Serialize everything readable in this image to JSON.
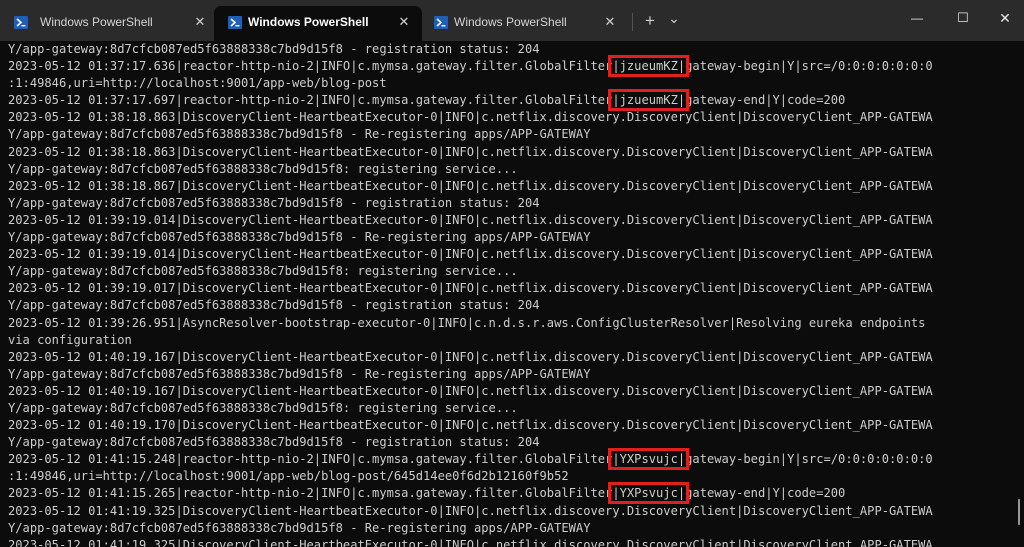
{
  "tabs": [
    {
      "label": "Windows PowerShell",
      "active": false
    },
    {
      "label": "Windows PowerShell",
      "active": true
    },
    {
      "label": "Windows PowerShell",
      "active": false
    }
  ],
  "toolbar": {
    "new_tab": "+",
    "dropdown": "⌄",
    "close_glyph": "✕"
  },
  "window_controls": {
    "minimize": "—",
    "maximize": "☐",
    "close": "✕"
  },
  "colors": {
    "terminal_bg": "#0c0c0c",
    "text": "#cccccc",
    "highlight_box": "#e0201f",
    "powershell_icon": "#1f5fb5"
  },
  "terminal": {
    "lines": [
      {
        "segments": [
          {
            "text": "Y/app-gateway:8d7cfcb087ed5f63888338c7bd9d15f8 - registration status: 204"
          }
        ]
      },
      {
        "segments": [
          {
            "text": "2023-05-12 01:37:17.636|reactor-http-nio-2|INFO|c.mymsa.gateway.filter.GlobalFilter"
          },
          {
            "text": "|jzueumKZ|",
            "highlight": true
          },
          {
            "text": "gateway-begin|Y|src=/0:0:0:0:0:0:0"
          }
        ]
      },
      {
        "segments": [
          {
            "text": ":1:49846,uri=http://localhost:9001/app-web/blog-post"
          }
        ]
      },
      {
        "segments": [
          {
            "text": "2023-05-12 01:37:17.697|reactor-http-nio-2|INFO|c.mymsa.gateway.filter.GlobalFilter"
          },
          {
            "text": "|jzueumKZ|",
            "highlight": true
          },
          {
            "text": "gateway-end|Y|code=200"
          }
        ]
      },
      {
        "segments": [
          {
            "text": "2023-05-12 01:38:18.863|DiscoveryClient-HeartbeatExecutor-0|INFO|c.netflix.discovery.DiscoveryClient|DiscoveryClient_APP-GATEWA"
          }
        ]
      },
      {
        "segments": [
          {
            "text": "Y/app-gateway:8d7cfcb087ed5f63888338c7bd9d15f8 - Re-registering apps/APP-GATEWAY"
          }
        ]
      },
      {
        "segments": [
          {
            "text": "2023-05-12 01:38:18.863|DiscoveryClient-HeartbeatExecutor-0|INFO|c.netflix.discovery.DiscoveryClient|DiscoveryClient_APP-GATEWA"
          }
        ]
      },
      {
        "segments": [
          {
            "text": "Y/app-gateway:8d7cfcb087ed5f63888338c7bd9d15f8: registering service..."
          }
        ]
      },
      {
        "segments": [
          {
            "text": "2023-05-12 01:38:18.867|DiscoveryClient-HeartbeatExecutor-0|INFO|c.netflix.discovery.DiscoveryClient|DiscoveryClient_APP-GATEWA"
          }
        ]
      },
      {
        "segments": [
          {
            "text": "Y/app-gateway:8d7cfcb087ed5f63888338c7bd9d15f8 - registration status: 204"
          }
        ]
      },
      {
        "segments": [
          {
            "text": "2023-05-12 01:39:19.014|DiscoveryClient-HeartbeatExecutor-0|INFO|c.netflix.discovery.DiscoveryClient|DiscoveryClient_APP-GATEWA"
          }
        ]
      },
      {
        "segments": [
          {
            "text": "Y/app-gateway:8d7cfcb087ed5f63888338c7bd9d15f8 - Re-registering apps/APP-GATEWAY"
          }
        ]
      },
      {
        "segments": [
          {
            "text": "2023-05-12 01:39:19.014|DiscoveryClient-HeartbeatExecutor-0|INFO|c.netflix.discovery.DiscoveryClient|DiscoveryClient_APP-GATEWA"
          }
        ]
      },
      {
        "segments": [
          {
            "text": "Y/app-gateway:8d7cfcb087ed5f63888338c7bd9d15f8: registering service..."
          }
        ]
      },
      {
        "segments": [
          {
            "text": "2023-05-12 01:39:19.017|DiscoveryClient-HeartbeatExecutor-0|INFO|c.netflix.discovery.DiscoveryClient|DiscoveryClient_APP-GATEWA"
          }
        ]
      },
      {
        "segments": [
          {
            "text": "Y/app-gateway:8d7cfcb087ed5f63888338c7bd9d15f8 - registration status: 204"
          }
        ]
      },
      {
        "segments": [
          {
            "text": "2023-05-12 01:39:26.951|AsyncResolver-bootstrap-executor-0|INFO|c.n.d.s.r.aws.ConfigClusterResolver|Resolving eureka endpoints"
          }
        ]
      },
      {
        "segments": [
          {
            "text": "via configuration"
          }
        ]
      },
      {
        "segments": [
          {
            "text": "2023-05-12 01:40:19.167|DiscoveryClient-HeartbeatExecutor-0|INFO|c.netflix.discovery.DiscoveryClient|DiscoveryClient_APP-GATEWA"
          }
        ]
      },
      {
        "segments": [
          {
            "text": "Y/app-gateway:8d7cfcb087ed5f63888338c7bd9d15f8 - Re-registering apps/APP-GATEWAY"
          }
        ]
      },
      {
        "segments": [
          {
            "text": "2023-05-12 01:40:19.167|DiscoveryClient-HeartbeatExecutor-0|INFO|c.netflix.discovery.DiscoveryClient|DiscoveryClient_APP-GATEWA"
          }
        ]
      },
      {
        "segments": [
          {
            "text": "Y/app-gateway:8d7cfcb087ed5f63888338c7bd9d15f8: registering service..."
          }
        ]
      },
      {
        "segments": [
          {
            "text": "2023-05-12 01:40:19.170|DiscoveryClient-HeartbeatExecutor-0|INFO|c.netflix.discovery.DiscoveryClient|DiscoveryClient_APP-GATEWA"
          }
        ]
      },
      {
        "segments": [
          {
            "text": "Y/app-gateway:8d7cfcb087ed5f63888338c7bd9d15f8 - registration status: 204"
          }
        ]
      },
      {
        "segments": [
          {
            "text": "2023-05-12 01:41:15.248|reactor-http-nio-2|INFO|c.mymsa.gateway.filter.GlobalFilter"
          },
          {
            "text": "|YXPsvujc|",
            "highlight": true
          },
          {
            "text": "gateway-begin|Y|src=/0:0:0:0:0:0:0"
          }
        ]
      },
      {
        "segments": [
          {
            "text": ":1:49846,uri=http://localhost:9001/app-web/blog-post/645d14ee0f6d2b12160f9b52"
          }
        ]
      },
      {
        "segments": [
          {
            "text": "2023-05-12 01:41:15.265|reactor-http-nio-2|INFO|c.mymsa.gateway.filter.GlobalFilter"
          },
          {
            "text": "|YXPsvujc|",
            "highlight": true
          },
          {
            "text": "gateway-end|Y|code=200"
          }
        ]
      },
      {
        "segments": [
          {
            "text": "2023-05-12 01:41:19.325|DiscoveryClient-HeartbeatExecutor-0|INFO|c.netflix.discovery.DiscoveryClient|DiscoveryClient_APP-GATEWA"
          }
        ]
      },
      {
        "segments": [
          {
            "text": "Y/app-gateway:8d7cfcb087ed5f63888338c7bd9d15f8 - Re-registering apps/APP-GATEWAY"
          }
        ]
      },
      {
        "segments": [
          {
            "text": "2023-05-12 01:41:19.325|DiscoveryClient-HeartbeatExecutor-0|INFO|c.netflix.discovery.DiscoveryClient|DiscoveryClient_APP-GATEWA"
          }
        ]
      }
    ]
  }
}
